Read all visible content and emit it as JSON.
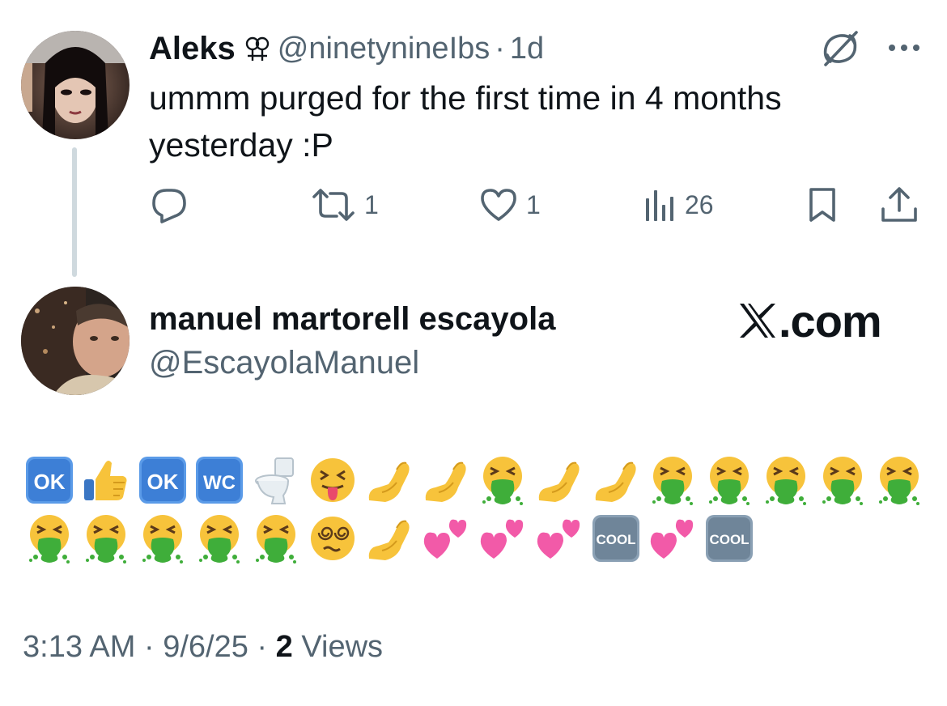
{
  "tweet1": {
    "display_name": "Aleks",
    "gender_icon": "double-female-sign",
    "handle": "@ninetynineIbs",
    "separator": "·",
    "time": "1d",
    "text": "ummm purged for the first time in 4 months yesterday :P",
    "retweets": "1",
    "likes": "1",
    "views": "26",
    "icons": [
      "reply-icon",
      "retweet-icon",
      "like-icon",
      "views-icon",
      "bookmark-icon",
      "share-icon",
      "grok-icon",
      "more-icon"
    ]
  },
  "tweet2": {
    "display_name": "manuel martorell escayola",
    "handle": "@EscayolaManuel",
    "brand": ".com",
    "brand_logo": "x-logo",
    "emoji_row_1": [
      "ok",
      "thumbs-up",
      "ok",
      "wc",
      "toilet",
      "tongue-face",
      "pinched",
      "pinched",
      "vomit",
      "pinched",
      "pinched",
      "vomit",
      "vomit",
      "vomit",
      "vomit",
      "vomit"
    ],
    "emoji_row_2": [
      "vomit",
      "vomit",
      "vomit",
      "vomit",
      "vomit",
      "dizzy-face",
      "pinched",
      "hearts",
      "hearts",
      "hearts",
      "cool",
      "hearts",
      "cool"
    ],
    "emoji_labels": {
      "ok": "OK",
      "wc": "WC",
      "cool": "COOL"
    },
    "footer": {
      "time": "3:13 AM",
      "sep1": "·",
      "date": "9/6/25",
      "sep2": "·",
      "views_count": "2",
      "views_label": "Views"
    }
  },
  "colors": {
    "text": "#0f1419",
    "secondary": "#536471",
    "thread_line": "#cfd9de",
    "key_blue": "#3d7fd6",
    "vomit_green": "#3fae3a",
    "emoji_yellow": "#f7c33b",
    "heart_pink": "#f25aa8"
  }
}
